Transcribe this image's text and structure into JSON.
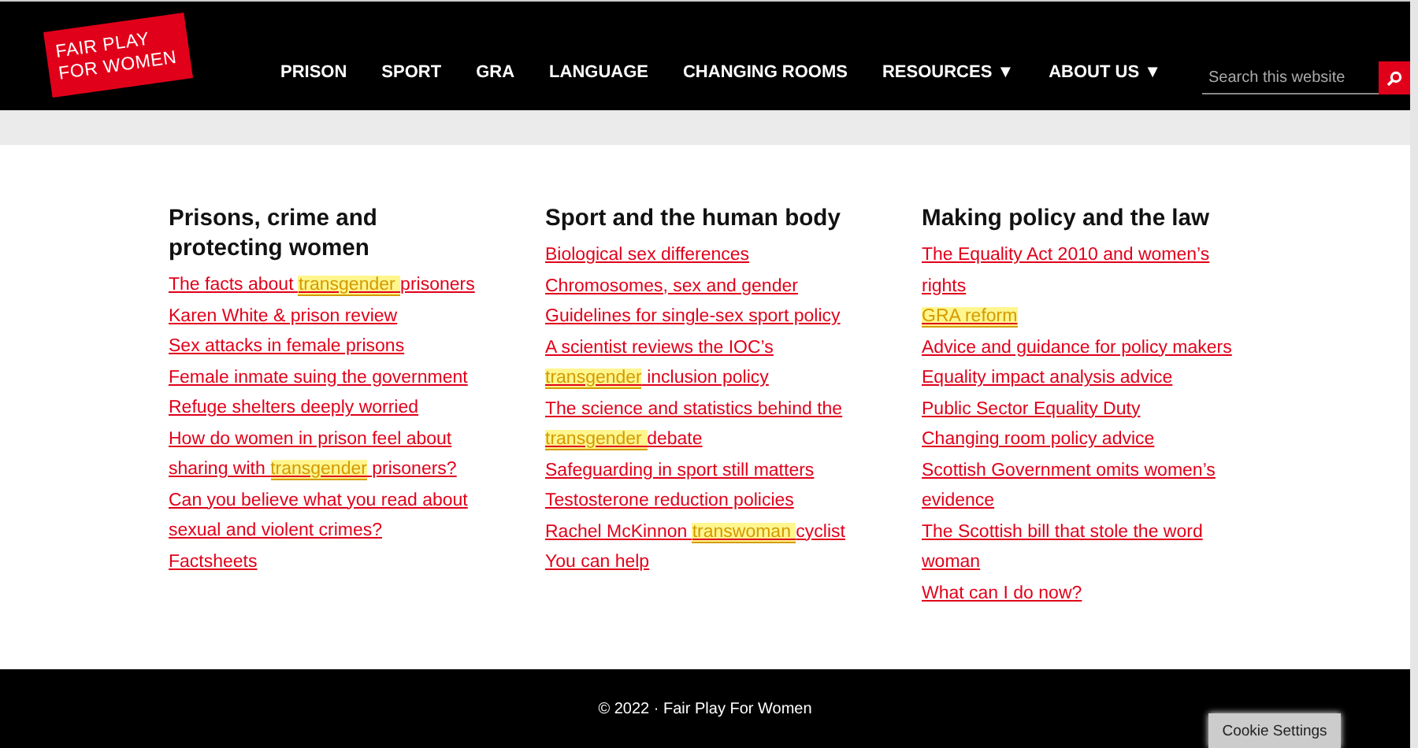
{
  "header": {
    "logo": [
      "FAIR PLAY",
      "FOR WOMEN"
    ],
    "nav": [
      {
        "label": "PRISON"
      },
      {
        "label": "SPORT"
      },
      {
        "label": "GRA"
      },
      {
        "label": "LANGUAGE"
      },
      {
        "label": "CHANGING ROOMS"
      },
      {
        "label": "RESOURCES ▼"
      },
      {
        "label": "ABOUT US ▼"
      }
    ],
    "search": {
      "placeholder": "Search this website"
    }
  },
  "columns": [
    {
      "heading": "Prisons, crime and protecting women",
      "links": [
        [
          {
            "text": "The facts about "
          },
          {
            "text": "transgender ",
            "highlighted": true
          },
          {
            "text": "prisoners"
          }
        ],
        [
          {
            "text": "Karen White & prison review"
          }
        ],
        [
          {
            "text": "Sex attacks in female prisons"
          }
        ],
        [
          {
            "text": "Female inmate suing the government"
          }
        ],
        [
          {
            "text": "Refuge shelters deeply worried"
          }
        ],
        [
          {
            "text": "How do women in prison feel about sharing with "
          },
          {
            "text": "transgender",
            "highlighted": true
          },
          {
            "text": " prisoners?"
          }
        ],
        [
          {
            "text": "Can you believe what you read about sexual and violent crimes?"
          }
        ],
        [
          {
            "text": "Factsheets"
          }
        ]
      ]
    },
    {
      "heading": "Sport and the human body",
      "links": [
        [
          {
            "text": "Biological sex differences"
          }
        ],
        [
          {
            "text": "Chromosomes, sex and gender"
          }
        ],
        [
          {
            "text": "Guidelines for single-sex sport policy"
          }
        ],
        [
          {
            "text": "A scientist reviews the IOC’s "
          },
          {
            "text": "transgender",
            "highlighted": true
          },
          {
            "text": " inclusion policy"
          }
        ],
        [
          {
            "text": "The science and statistics behind the "
          },
          {
            "text": "transgender ",
            "highlighted": true
          },
          {
            "text": "debate"
          }
        ],
        [
          {
            "text": "Safeguarding in sport still matters"
          }
        ],
        [
          {
            "text": "Testosterone reduction policies"
          }
        ],
        [
          {
            "text": "Rachel McKinnon "
          },
          {
            "text": "transwoman ",
            "highlighted": true
          },
          {
            "text": "cyclist"
          }
        ],
        [
          {
            "text": "You can help"
          }
        ]
      ]
    },
    {
      "heading": "Making policy and the law",
      "links": [
        [
          {
            "text": "The Equality Act 2010 and women’s rights"
          }
        ],
        [
          {
            "text": "GRA reform",
            "highlighted": true
          }
        ],
        [
          {
            "text": "Advice and guidance for policy makers"
          }
        ],
        [
          {
            "text": "Equality impact analysis advice"
          }
        ],
        [
          {
            "text": "Public Sector Equality Duty"
          }
        ],
        [
          {
            "text": "Changing room policy advice"
          }
        ],
        [
          {
            "text": "Scottish Government omits women’s evidence"
          }
        ],
        [
          {
            "text": "The Scottish bill that stole the word woman"
          }
        ],
        [
          {
            "text": "What can I do now?"
          }
        ]
      ]
    }
  ],
  "footer": {
    "copyright": "© 2022 · Fair Play For Women",
    "cookie_button": "Cookie Settings"
  }
}
